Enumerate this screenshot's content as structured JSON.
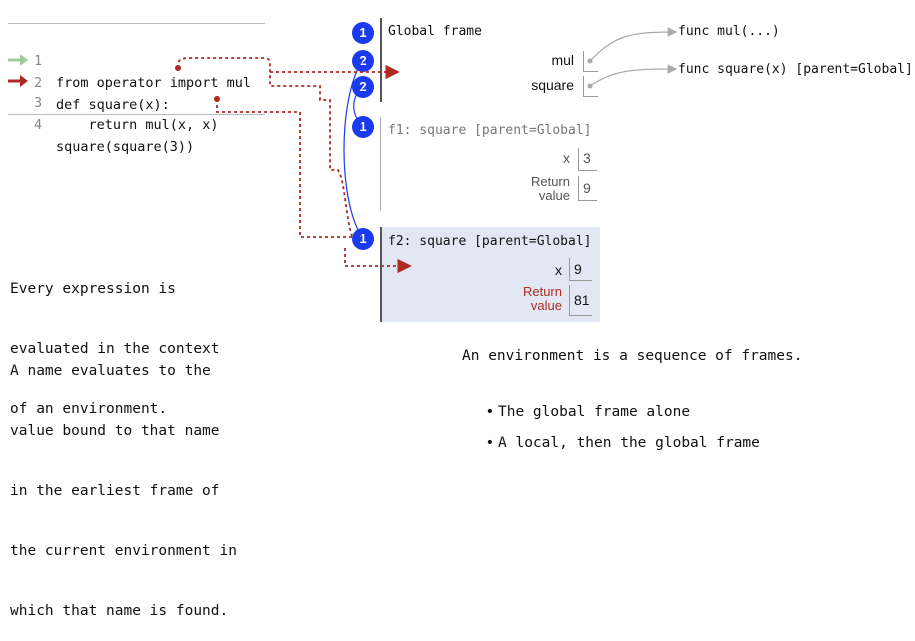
{
  "code": {
    "lines": [
      {
        "num": "1",
        "text": "from operator import mul"
      },
      {
        "num": "2",
        "text": "def square(x):"
      },
      {
        "num": "3",
        "text": "    return mul(x, x)"
      },
      {
        "num": "4",
        "text": "square(square(3))"
      }
    ]
  },
  "global_frame": {
    "badge": "1",
    "title": "Global frame",
    "vars": [
      {
        "name": "mul",
        "badge": "2"
      },
      {
        "name": "square",
        "badge": "2"
      }
    ],
    "objects": [
      "func mul(...)",
      "func square(x) [parent=Global]"
    ]
  },
  "f1": {
    "badge": "1",
    "title": "f1: square [parent=Global]",
    "x_name": "x",
    "x_value": "3",
    "ret_line1": "Return",
    "ret_line2": "value",
    "ret_value": "9"
  },
  "f2": {
    "badge": "1",
    "title": "f2: square [parent=Global]",
    "x_name": "x",
    "x_value": "9",
    "ret_line1": "Return",
    "ret_line2": "value",
    "ret_value": "81"
  },
  "left_text": {
    "p1": [
      "Every expression is",
      "evaluated in the context",
      "of an environment."
    ],
    "p2": [
      "A name evaluates to the",
      "value bound to that name",
      "in the earliest frame of",
      "the current environment in",
      "which that name is found."
    ]
  },
  "right_text": {
    "heading": "An environment is a sequence of frames.",
    "bullets": [
      "The global frame alone",
      "A local, then the global frame"
    ]
  },
  "colors": {
    "badge": "#1a3aef",
    "arrow_red": "#b02a23",
    "arrow_green": "#9fcc9a",
    "active_frame_bg": "#e2e8f3"
  }
}
